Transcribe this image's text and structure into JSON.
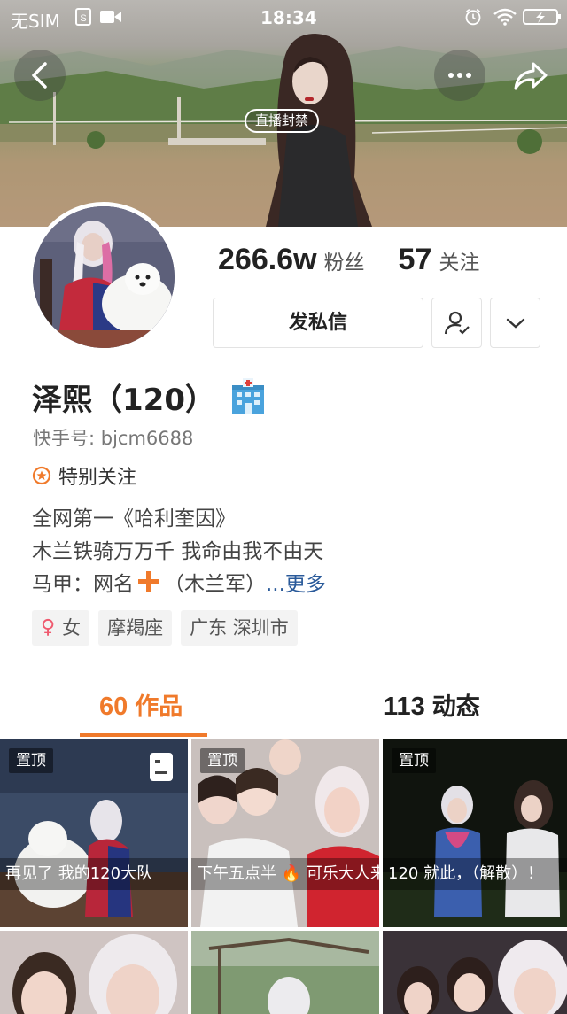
{
  "status_bar": {
    "carrier": "无SIM",
    "time": "18:34"
  },
  "cover": {
    "live_ban_label": "直播封禁"
  },
  "profile": {
    "followers_count": "266.6w",
    "followers_label": "粉丝",
    "following_count": "57",
    "following_label": "关注",
    "message_button_label": "发私信",
    "name": "泽熙（120）",
    "kuaishou_id": "快手号: bjcm6688",
    "special_follow_label": "特别关注",
    "bio": {
      "line1": "全网第一《哈利奎因》",
      "line2": "木兰铁骑万万千  我命由我不由天",
      "line3_prefix": "马甲：网名",
      "line3_suffix": "（木兰军）",
      "more_link": "...更多"
    },
    "tags": {
      "gender": "女",
      "gender_symbol": "♀",
      "zodiac": "摩羯座",
      "location": "广东 深圳市"
    }
  },
  "tabs": {
    "works": {
      "count": "60",
      "label": "作品"
    },
    "feed": {
      "count": "113",
      "label": "动态"
    }
  },
  "grid": {
    "items": [
      {
        "pinned_label": "置顶",
        "caption": "再见了 我的120大队"
      },
      {
        "pinned_label": "置顶",
        "caption": "下午五点半 🔥 可乐大人来啦"
      },
      {
        "pinned_label": "置顶",
        "caption": "120 就此，（解散）！"
      }
    ]
  },
  "colors": {
    "accent": "#f07a2b",
    "link": "#2a5a9a",
    "gender_female": "#ef5a6f"
  },
  "icons": [
    "sim-card-icon",
    "video-icon",
    "alarm-icon",
    "wifi-icon",
    "battery-icon",
    "back-icon",
    "more-icon",
    "share-icon",
    "add-friend-icon",
    "chevron-down-icon",
    "hospital-icon",
    "star-icon",
    "plus-icon",
    "female-icon",
    "long-image-icon"
  ]
}
